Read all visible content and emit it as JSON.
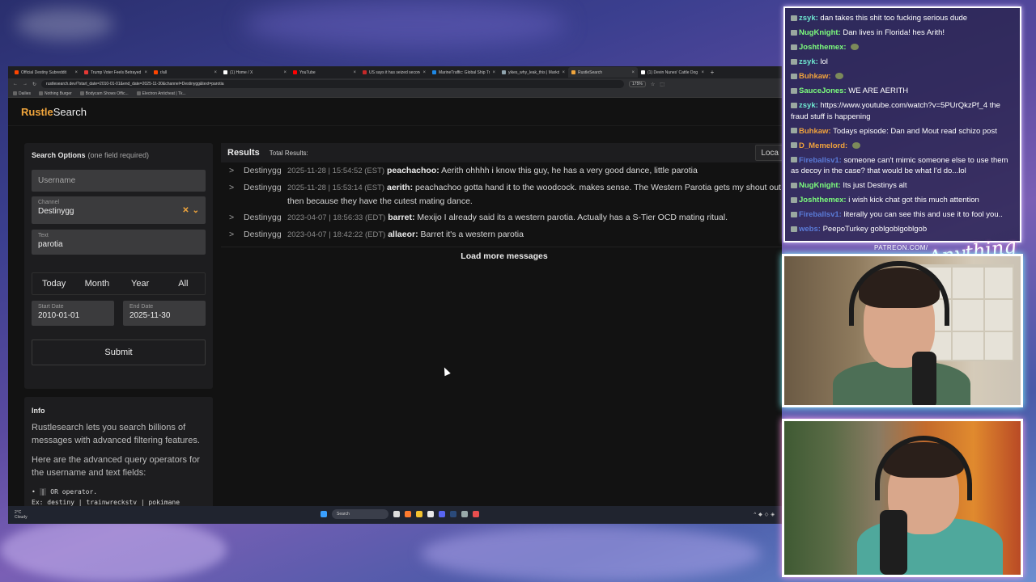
{
  "browser": {
    "tabs": [
      {
        "title": "Official Destiny Subreddit",
        "color": "#ff4500",
        "active": false
      },
      {
        "title": "Trump Voter Feels Betrayed By",
        "color": "#e53935",
        "active": false
      },
      {
        "title": "r/all",
        "color": "#ff4500",
        "active": false
      },
      {
        "title": "(1) Home / X",
        "color": "#ffffff",
        "active": false
      },
      {
        "title": "YouTube",
        "color": "#ff0000",
        "active": false
      },
      {
        "title": "US says it has seized second ta",
        "color": "#c62828",
        "active": false
      },
      {
        "title": "MarineTraffic: Global Ship Tracki",
        "color": "#1e88e5",
        "active": false
      },
      {
        "title": "yikes_why_leak_this | Markdow",
        "color": "#90a4ae",
        "active": false
      },
      {
        "title": "RustleSearch",
        "color": "#f0a53c",
        "active": true
      },
      {
        "title": "(1) Devin Nunes' Cattle Dog",
        "color": "#ffffff",
        "active": false
      }
    ],
    "url": "rustlesearch.dev/?start_date=2010-01-01&end_date=2025-11-30&channel=Destinygg&text=parotia",
    "zoom": "175%",
    "bookmarks": [
      "Dailies",
      "Nothing Burger",
      "Bodycam Shows Offic...",
      "Electron Anticheat | Tk..."
    ]
  },
  "site": {
    "logo_part1": "Rustle",
    "logo_part2": "Search"
  },
  "search": {
    "title": "Search Options",
    "subtitle": "(one field required)",
    "username_placeholder": "Username",
    "channel_label": "Channel",
    "channel_value": "Destinygg",
    "text_label": "Text",
    "text_value": "parotia",
    "ranges": [
      "Today",
      "Month",
      "Year",
      "All"
    ],
    "start_label": "Start Date",
    "start_value": "2010-01-01",
    "end_label": "End Date",
    "end_value": "2025-11-30",
    "submit": "Submit"
  },
  "info": {
    "title": "Info",
    "para1": "Rustlesearch lets you search billions of messages with advanced filtering features.",
    "para2": "Here are the advanced query operators for the username and text fields:",
    "op1_symbol": "|",
    "op1_text": "OR operator.",
    "example": "Ex: destiny | trainwreckstv | pokimane"
  },
  "results": {
    "title": "Results",
    "total_label": "Total Results:",
    "local_button": "Loca",
    "messages": [
      {
        "channel": "Destinygg",
        "time": "2025-11-28 | 15:54:52 (EST)",
        "user": "peachachoo:",
        "text": "Aerith ohhhh i know this guy, he has a very good dance, little parotia"
      },
      {
        "channel": "Destinygg",
        "time": "2025-11-28 | 15:53:14 (EST)",
        "user": "aerith:",
        "text": "peachachoo gotta hand it to the woodcock. makes sense. The Western Parotia gets my shout out then because they have the cutest mating dance."
      },
      {
        "channel": "Destinygg",
        "time": "2023-04-07 | 18:56:33 (EDT)",
        "user": "barret:",
        "text": "Mexijo I already said its a western parotia. Actually has a S-Tier OCD mating ritual."
      },
      {
        "channel": "Destinygg",
        "time": "2023-04-07 | 18:42:22 (EDT)",
        "user": "allaeor:",
        "text": "Barret it's a western parotia"
      }
    ],
    "load_more": "Load more messages"
  },
  "taskbar": {
    "weather_temp": "2°C",
    "weather_desc": "Cloudy",
    "search": "Search"
  },
  "chat": {
    "messages": [
      {
        "user": "zsyk:",
        "color": "#6fe8d0",
        "text": "dan takes this shit too fucking serious dude"
      },
      {
        "user": "NugKnight:",
        "color": "#7cfc7c",
        "text": "Dan lives in Florida! hes Arith!"
      },
      {
        "user": "Joshthemex:",
        "color": "#7cfc7c",
        "text": ""
      },
      {
        "user": "zsyk:",
        "color": "#6fe8d0",
        "text": "lol"
      },
      {
        "user": "Buhkaw:",
        "color": "#f0a23c",
        "text": ""
      },
      {
        "user": "SauceJones:",
        "color": "#7cfc7c",
        "text": "WE ARE AERITH"
      },
      {
        "user": "zsyk:",
        "color": "#6fe8d0",
        "text": "https://www.youtube.com/watch?v=5PUrQkzPf_4 the fraud stuff is happening"
      },
      {
        "user": "Buhkaw:",
        "color": "#f0a23c",
        "text": "Todays episode: Dan and Mout read schizo post"
      },
      {
        "user": "D_Memelord:",
        "color": "#f0a23c",
        "text": ""
      },
      {
        "user": "Fireballsv1:",
        "color": "#5a7bd8",
        "text": "someone can't mimic someone else to use them as decoy in the case? that would be what I'd do...lol"
      },
      {
        "user": "NugKnight:",
        "color": "#7cfc7c",
        "text": "Its just Destinys alt"
      },
      {
        "user": "Joshthemex:",
        "color": "#7cfc7c",
        "text": "i wish kick chat got this much attention"
      },
      {
        "user": "Fireballsv1:",
        "color": "#5a7bd8",
        "text": "literally you can see this and use it to fool you.."
      },
      {
        "user": "webs:",
        "color": "#5a7bd8",
        "text": "PeepoTurkey goblgoblgoblgob"
      }
    ]
  },
  "overlay": {
    "patreon": "PATREON.COM/",
    "signature": "Anything Else?"
  }
}
